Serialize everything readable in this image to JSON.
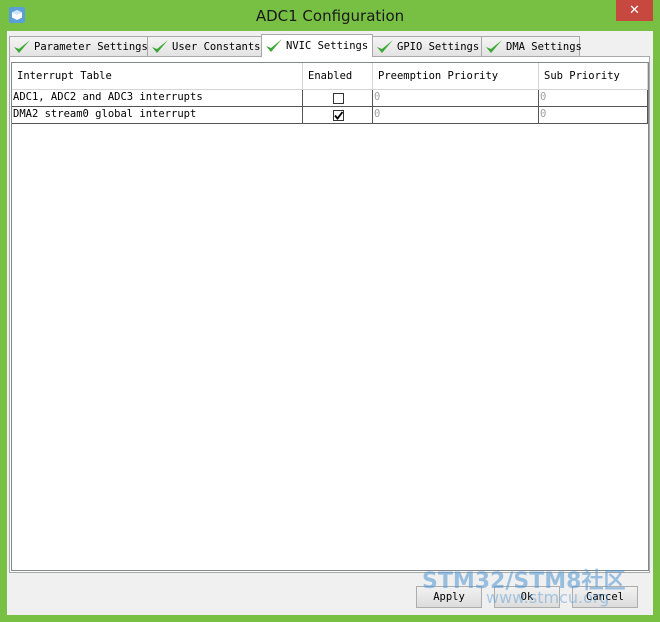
{
  "window": {
    "title": "ADC1 Configuration",
    "close_label": "✕"
  },
  "tabs": [
    {
      "label": "Parameter Settings",
      "active": false
    },
    {
      "label": "User Constants",
      "active": false
    },
    {
      "label": "NVIC Settings",
      "active": true
    },
    {
      "label": "GPIO Settings",
      "active": false
    },
    {
      "label": "DMA Settings",
      "active": false
    }
  ],
  "table": {
    "headers": [
      "Interrupt Table",
      "Enabled",
      "Preemption Priority",
      "Sub Priority"
    ],
    "rows": [
      {
        "name": "ADC1, ADC2 and ADC3 interrupts",
        "enabled": false,
        "preemption": "0",
        "sub": "0"
      },
      {
        "name": "DMA2 stream0 global interrupt",
        "enabled": true,
        "preemption": "0",
        "sub": "0"
      }
    ]
  },
  "buttons": {
    "apply": "Apply",
    "ok": "Ok",
    "cancel": "Cancel"
  },
  "watermark": {
    "brand": "STM32/STM8社区",
    "url": "www.stmcu.org"
  },
  "colors": {
    "frame": "#77c043",
    "close": "#c7483f",
    "check": "#3aa832"
  }
}
